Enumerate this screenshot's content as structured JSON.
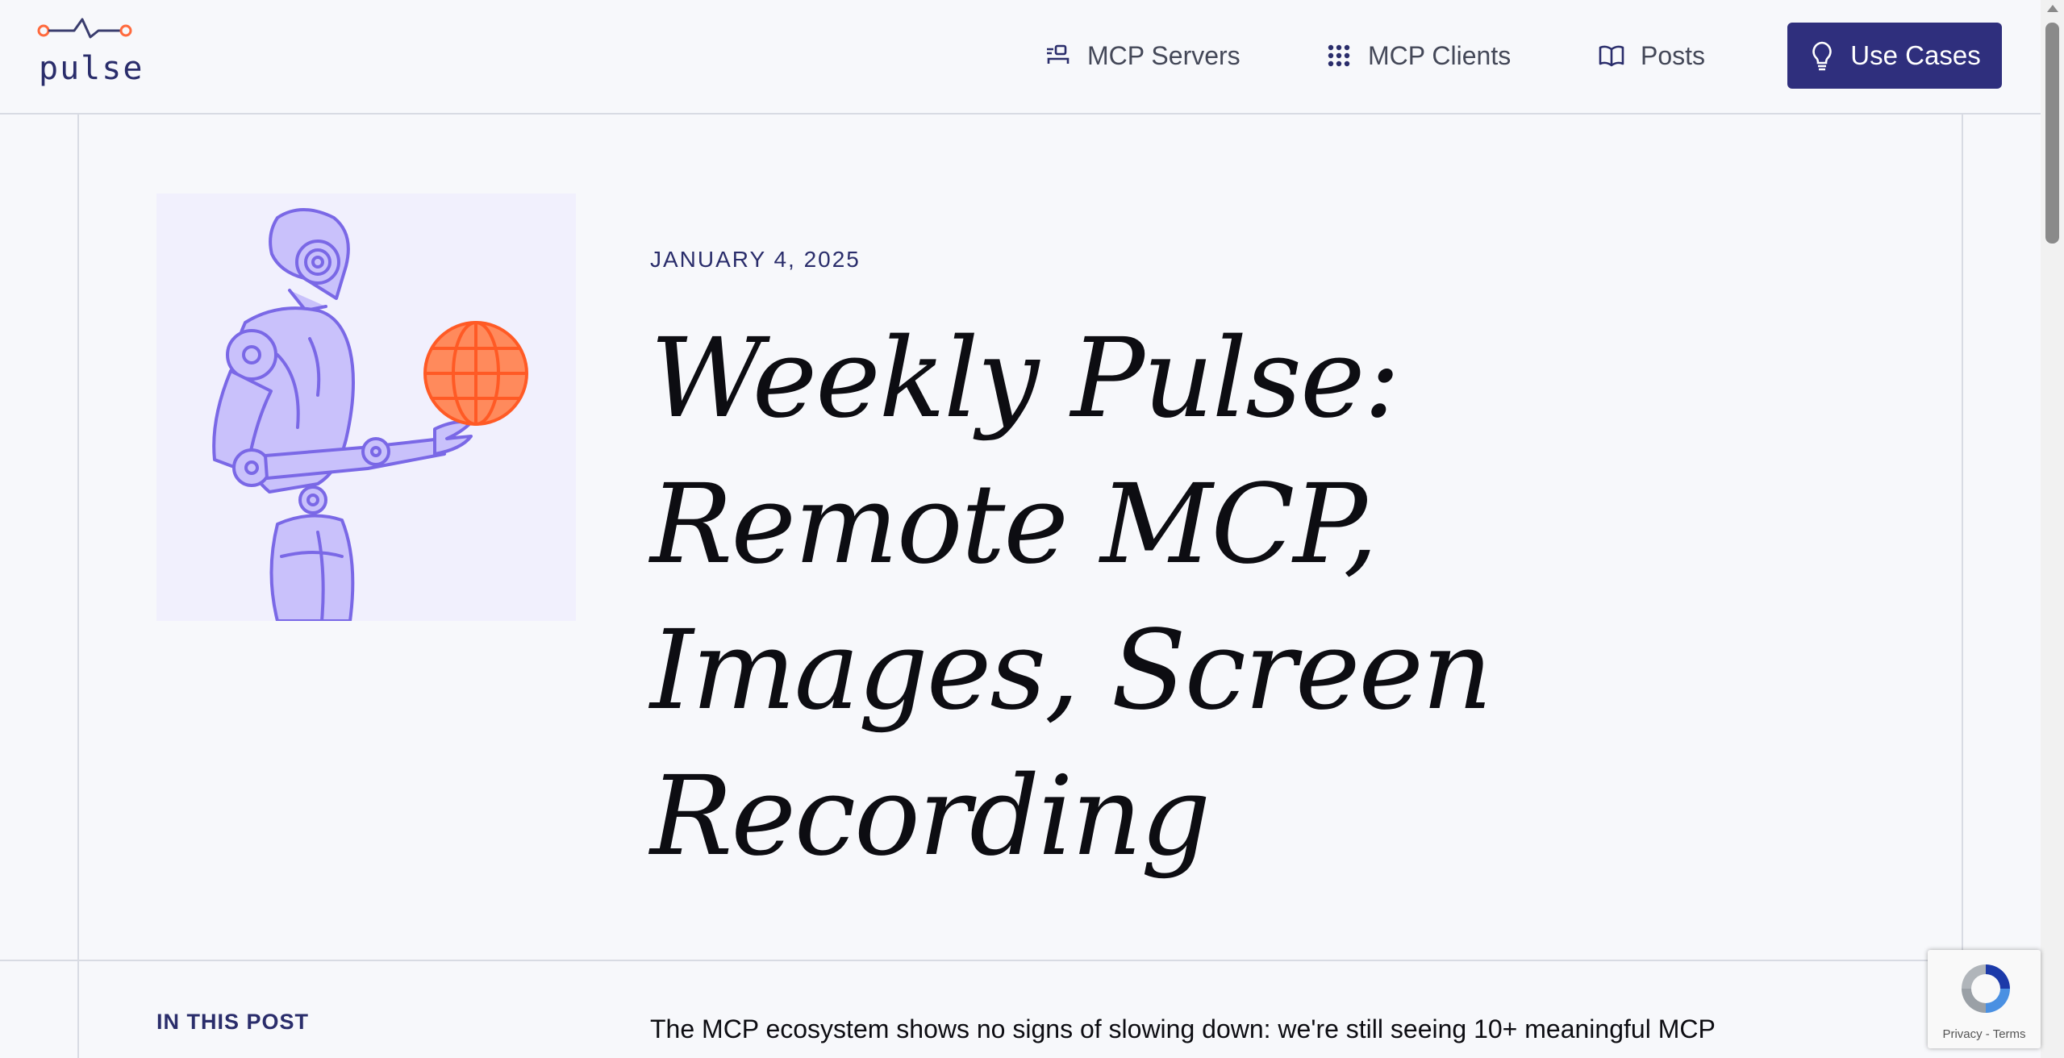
{
  "brand": {
    "name": "pulse"
  },
  "nav": {
    "items": [
      {
        "label": "MCP Servers",
        "icon": "server-user-icon"
      },
      {
        "label": "MCP Clients",
        "icon": "grid-dots-icon"
      },
      {
        "label": "Posts",
        "icon": "book-open-icon"
      }
    ],
    "cta": {
      "label": "Use Cases",
      "icon": "lightbulb-icon"
    }
  },
  "post": {
    "date": "JANUARY 4, 2025",
    "title": "Weekly Pulse: Remote MCP, Images, Screen Recording",
    "toc_label": "IN THIS POST",
    "intro": "The MCP ecosystem shows no signs of slowing down: we're still seeing 10+ meaningful MCP"
  },
  "recaptcha": {
    "privacy": "Privacy",
    "separator": " - ",
    "terms": "Terms"
  },
  "colors": {
    "accent": "#2f2f7d",
    "robot": "#c9c1fb",
    "robot_stroke": "#7a68e6",
    "globe": "#ff7a45"
  }
}
